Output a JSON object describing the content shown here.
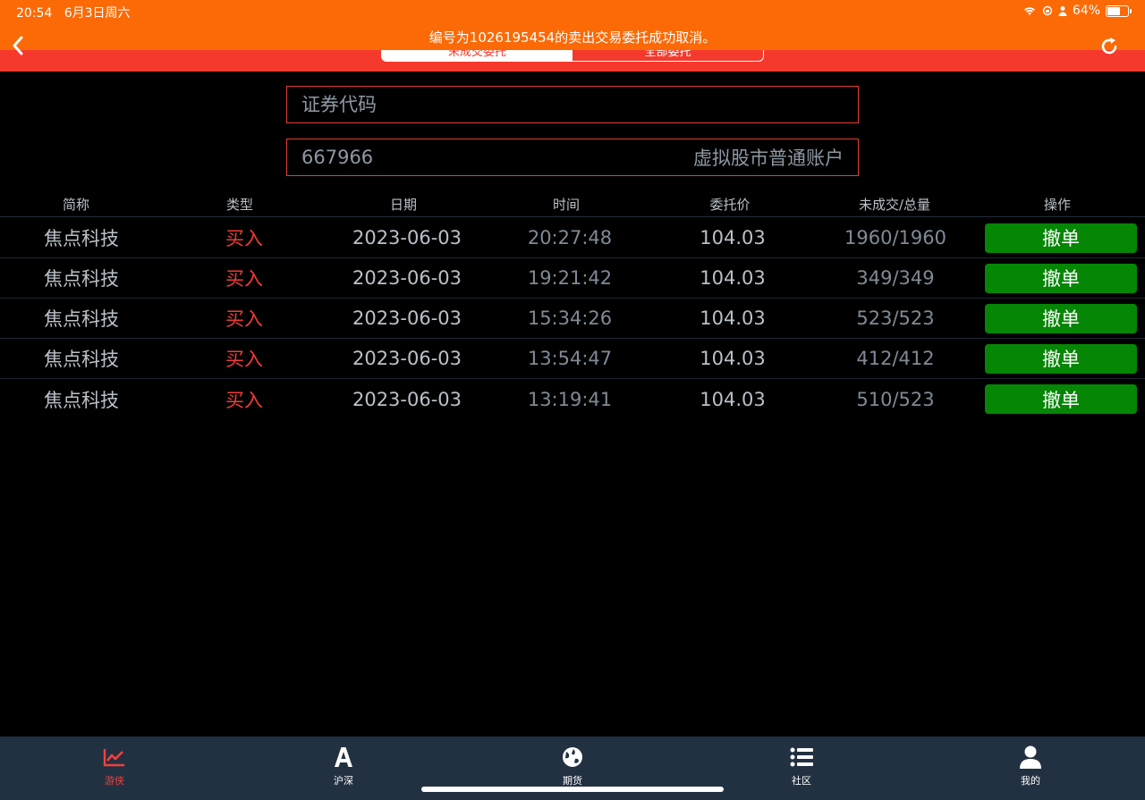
{
  "status_bar": {
    "time": "20:54",
    "date": "6月3日周六",
    "battery": "64%",
    "battery_level": 0.64
  },
  "toast": {
    "message": "编号为1026195454的卖出交易委托成功取消。"
  },
  "segment": {
    "tabs": [
      {
        "label": "未成交委托"
      },
      {
        "label": "全部委托"
      }
    ]
  },
  "search": {
    "placeholder": "证券代码"
  },
  "account": {
    "number": "667966",
    "type": "虚拟股市普通账户"
  },
  "table": {
    "headers": [
      "简称",
      "类型",
      "日期",
      "时间",
      "委托价",
      "未成交/总量",
      "操作"
    ],
    "rows": [
      {
        "name": "焦点科技",
        "type": "买入",
        "date": "2023-06-03",
        "time": "20:27:48",
        "price": "104.03",
        "qty": "1960/1960",
        "action": "撤单"
      },
      {
        "name": "焦点科技",
        "type": "买入",
        "date": "2023-06-03",
        "time": "19:21:42",
        "price": "104.03",
        "qty": "349/349",
        "action": "撤单"
      },
      {
        "name": "焦点科技",
        "type": "买入",
        "date": "2023-06-03",
        "time": "15:34:26",
        "price": "104.03",
        "qty": "523/523",
        "action": "撤单"
      },
      {
        "name": "焦点科技",
        "type": "买入",
        "date": "2023-06-03",
        "time": "13:54:47",
        "price": "104.03",
        "qty": "412/412",
        "action": "撤单"
      },
      {
        "name": "焦点科技",
        "type": "买入",
        "date": "2023-06-03",
        "time": "13:19:41",
        "price": "104.03",
        "qty": "510/523",
        "action": "撤单"
      }
    ]
  },
  "tabbar": {
    "items": [
      {
        "label": "游侠",
        "icon": "line-chart-icon"
      },
      {
        "label": "沪深",
        "icon": "letter-a-icon"
      },
      {
        "label": "期货",
        "icon": "globe-icon"
      },
      {
        "label": "社区",
        "icon": "list-icon"
      },
      {
        "label": "我的",
        "icon": "user-icon"
      }
    ]
  },
  "colors": {
    "header_red": "#f53a2d",
    "toast_orange": "#fb6a06",
    "buy_red": "#f23b36",
    "cancel_green": "#058605",
    "tabbar_bg": "#223142",
    "active_tab": "#f0413b"
  }
}
